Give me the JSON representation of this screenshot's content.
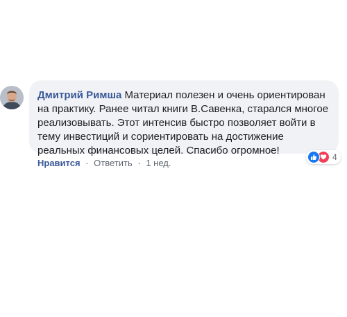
{
  "comment": {
    "author": "Дмитрий Римша",
    "text": "Материал полезен и очень ориентирован на практику. Ранее читал книги В.Савенка, старался многое реализовывать. Этот интенсив быстро позволяет войти в тему инвестиций и сориентировать на достижение реальных финансовых целей. Спасибо огромное!",
    "like_label": "Нравится",
    "reply_label": "Ответить",
    "separator": "·",
    "timestamp": "1 нед.",
    "reactions": {
      "icons": [
        "like-icon",
        "love-icon"
      ],
      "count": "4"
    }
  },
  "colors": {
    "bubble": "#f0f2f5",
    "author": "#385898",
    "text": "#1c1e21",
    "meta": "#606770",
    "like_reaction": "#1877f2",
    "love_reaction": "#f33e58"
  }
}
